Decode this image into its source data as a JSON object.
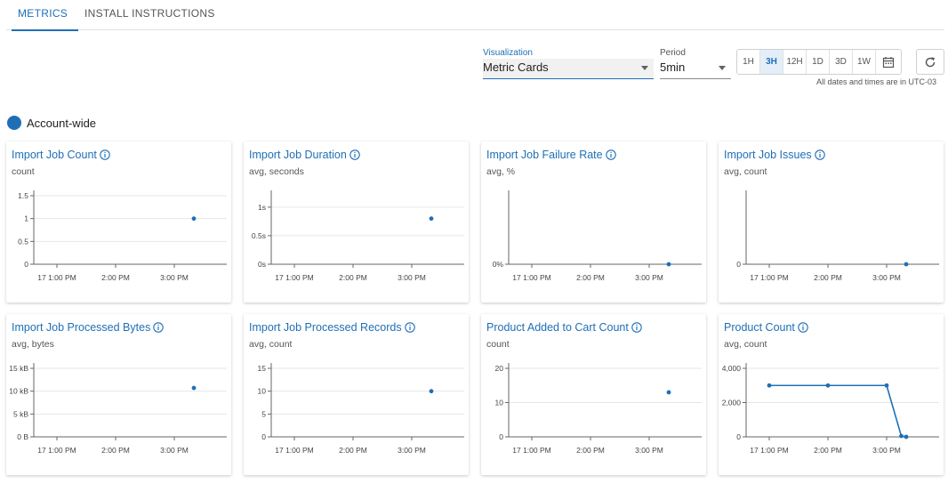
{
  "tabs": [
    {
      "label": "METRICS",
      "active": true
    },
    {
      "label": "INSTALL INSTRUCTIONS",
      "active": false
    }
  ],
  "controls": {
    "visualization_label": "Visualization",
    "visualization_value": "Metric Cards",
    "period_label": "Period",
    "period_value": "5min",
    "ranges": [
      "1H",
      "3H",
      "12H",
      "1D",
      "3D",
      "1W"
    ],
    "active_range": "3H",
    "timezone_note": "All dates and times are in UTC-03"
  },
  "scope": {
    "label": "Account-wide",
    "color": "#1f6fb6"
  },
  "colors": {
    "accent": "#1f6fb6",
    "series": "#1f6fb6"
  },
  "x_ticks": [
    "17 1:00 PM",
    "2:00 PM",
    "3:00 PM"
  ],
  "cards": [
    {
      "title": "Import Job Count",
      "subtitle": "count",
      "chart_data": {
        "type": "scatter",
        "y_ticks": [
          "1.5",
          "1",
          "0.5",
          "0"
        ],
        "ylim": [
          0,
          1.5
        ],
        "x": [
          "15:20"
        ],
        "values": [
          1
        ]
      }
    },
    {
      "title": "Import Job Duration",
      "subtitle": "avg, seconds",
      "chart_data": {
        "type": "scatter",
        "y_ticks": [
          "1s",
          "0.5s",
          "0s"
        ],
        "ylim": [
          0,
          1.2
        ],
        "x": [
          "15:20"
        ],
        "values": [
          0.8
        ]
      }
    },
    {
      "title": "Import Job Failure Rate",
      "subtitle": "avg, %",
      "chart_data": {
        "type": "scatter",
        "y_ticks": [
          "0%"
        ],
        "ylim": [
          0,
          1
        ],
        "x": [
          "15:20"
        ],
        "values": [
          0
        ]
      }
    },
    {
      "title": "Import Job Issues",
      "subtitle": "avg, count",
      "chart_data": {
        "type": "scatter",
        "y_ticks": [
          "0"
        ],
        "ylim": [
          0,
          1
        ],
        "x": [
          "15:20"
        ],
        "values": [
          0
        ]
      }
    },
    {
      "title": "Import Job Processed Bytes",
      "subtitle": "avg, bytes",
      "chart_data": {
        "type": "scatter",
        "y_ticks": [
          "15 kB",
          "10 kB",
          "5 kB",
          "0 B"
        ],
        "ylim": [
          0,
          15000
        ],
        "x": [
          "15:20"
        ],
        "values": [
          10700
        ]
      }
    },
    {
      "title": "Import Job Processed Records",
      "subtitle": "avg, count",
      "chart_data": {
        "type": "scatter",
        "y_ticks": [
          "15",
          "10",
          "5",
          "0"
        ],
        "ylim": [
          0,
          15
        ],
        "x": [
          "15:20"
        ],
        "values": [
          10
        ]
      }
    },
    {
      "title": "Product Added to Cart Count",
      "subtitle": "count",
      "chart_data": {
        "type": "scatter",
        "y_ticks": [
          "20",
          "10",
          "0"
        ],
        "ylim": [
          0,
          20
        ],
        "x": [
          "15:20"
        ],
        "values": [
          13
        ]
      }
    },
    {
      "title": "Product Count",
      "subtitle": "avg, count",
      "chart_data": {
        "type": "line",
        "y_ticks": [
          "4,000",
          "2,000",
          "0"
        ],
        "ylim": [
          0,
          4000
        ],
        "x": [
          "13:00",
          "14:00",
          "15:00",
          "15:15",
          "15:20"
        ],
        "values": [
          3000,
          3000,
          3000,
          50,
          0
        ]
      }
    }
  ]
}
